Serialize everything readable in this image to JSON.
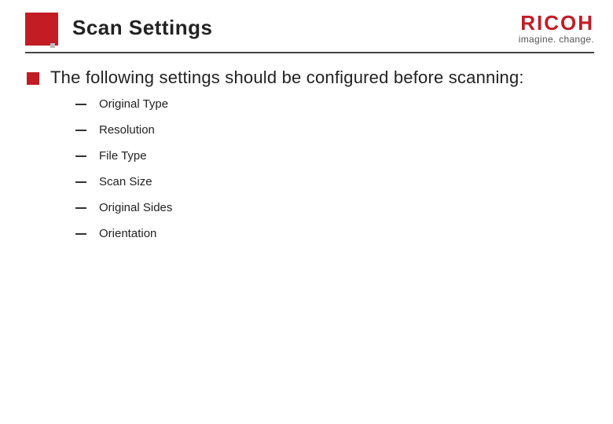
{
  "brand": {
    "name": "RICOH",
    "tagline": "imagine. change."
  },
  "title": "Scan Settings",
  "intro": "The following settings should be configured before scanning:",
  "items": [
    "Original Type",
    "Resolution",
    "File Type",
    "Scan Size",
    "Original Sides",
    "Orientation"
  ]
}
